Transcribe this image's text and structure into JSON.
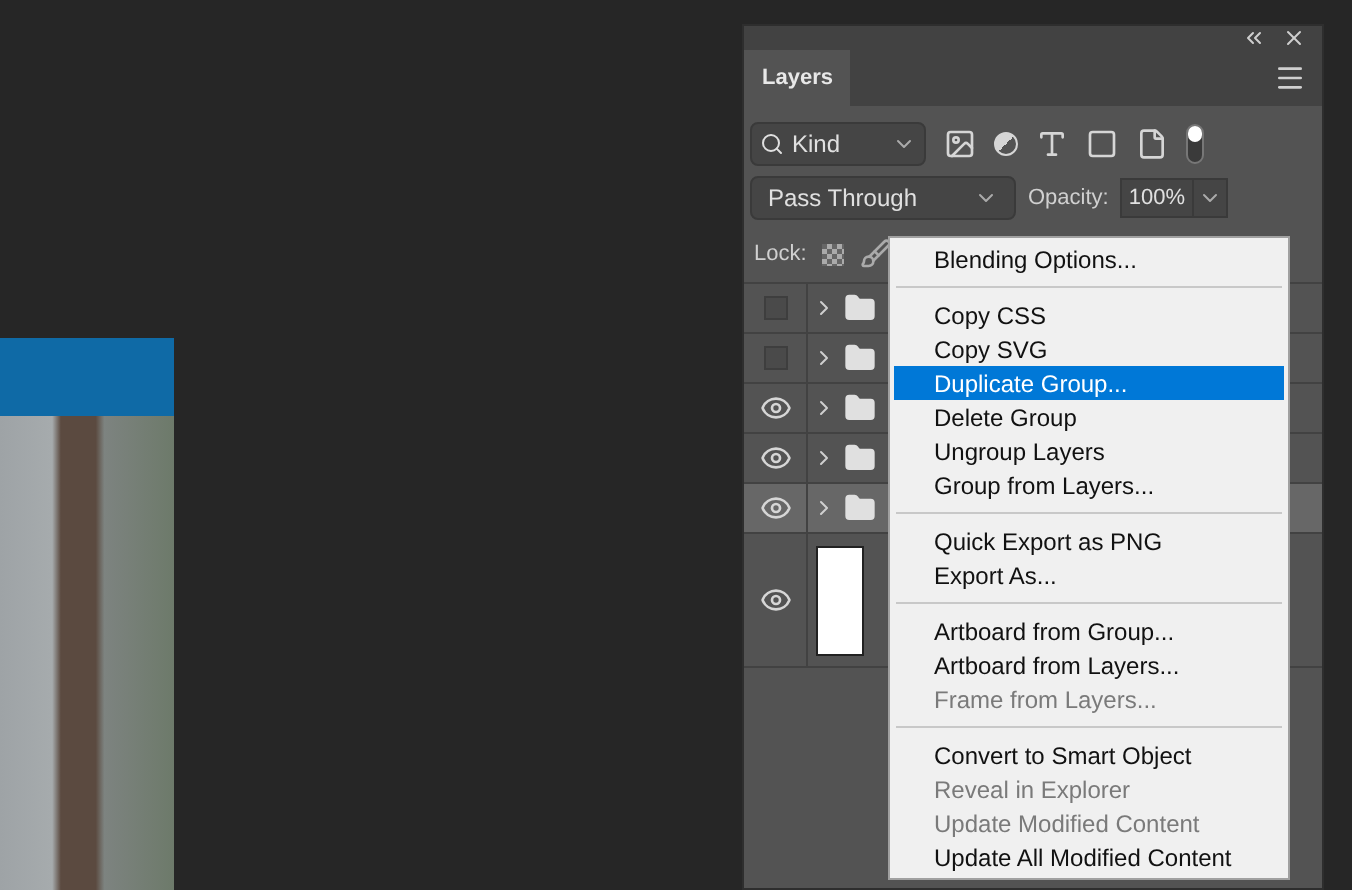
{
  "panel": {
    "tab": {
      "label": "Layers",
      "selected": true
    },
    "filter": {
      "value": "Kind",
      "on": true
    },
    "blend_mode": {
      "value": "Pass Through"
    },
    "opacity": {
      "label": "Opacity:",
      "value": "100%"
    },
    "lock": {
      "label": "Lock:"
    },
    "layers": [
      {
        "kind": "group",
        "visible": false,
        "selected": false
      },
      {
        "kind": "group",
        "visible": false,
        "selected": false
      },
      {
        "kind": "group",
        "visible": true,
        "selected": false
      },
      {
        "kind": "group",
        "visible": true,
        "selected": false
      },
      {
        "kind": "group",
        "visible": true,
        "selected": true
      },
      {
        "kind": "background",
        "visible": true,
        "selected": false
      }
    ]
  },
  "context_menu": {
    "groups": [
      [
        {
          "label": "Blending Options...",
          "disabled": false,
          "selected": false
        }
      ],
      [
        {
          "label": "Copy CSS",
          "disabled": false,
          "selected": false
        },
        {
          "label": "Copy SVG",
          "disabled": false,
          "selected": false
        },
        {
          "label": "Duplicate Group...",
          "disabled": false,
          "selected": true
        },
        {
          "label": "Delete Group",
          "disabled": false,
          "selected": false
        },
        {
          "label": "Ungroup Layers",
          "disabled": false,
          "selected": false
        },
        {
          "label": "Group from Layers...",
          "disabled": false,
          "selected": false
        }
      ],
      [
        {
          "label": "Quick Export as PNG",
          "disabled": false,
          "selected": false
        },
        {
          "label": "Export As...",
          "disabled": false,
          "selected": false
        }
      ],
      [
        {
          "label": "Artboard from Group...",
          "disabled": false,
          "selected": false
        },
        {
          "label": "Artboard from Layers...",
          "disabled": false,
          "selected": false
        },
        {
          "label": "Frame from Layers...",
          "disabled": true,
          "selected": false
        }
      ],
      [
        {
          "label": "Convert to Smart Object",
          "disabled": false,
          "selected": false
        },
        {
          "label": "Reveal in Explorer",
          "disabled": true,
          "selected": false
        },
        {
          "label": "Update Modified Content",
          "disabled": true,
          "selected": false
        },
        {
          "label": "Update All Modified Content",
          "disabled": false,
          "selected": false
        }
      ]
    ]
  }
}
